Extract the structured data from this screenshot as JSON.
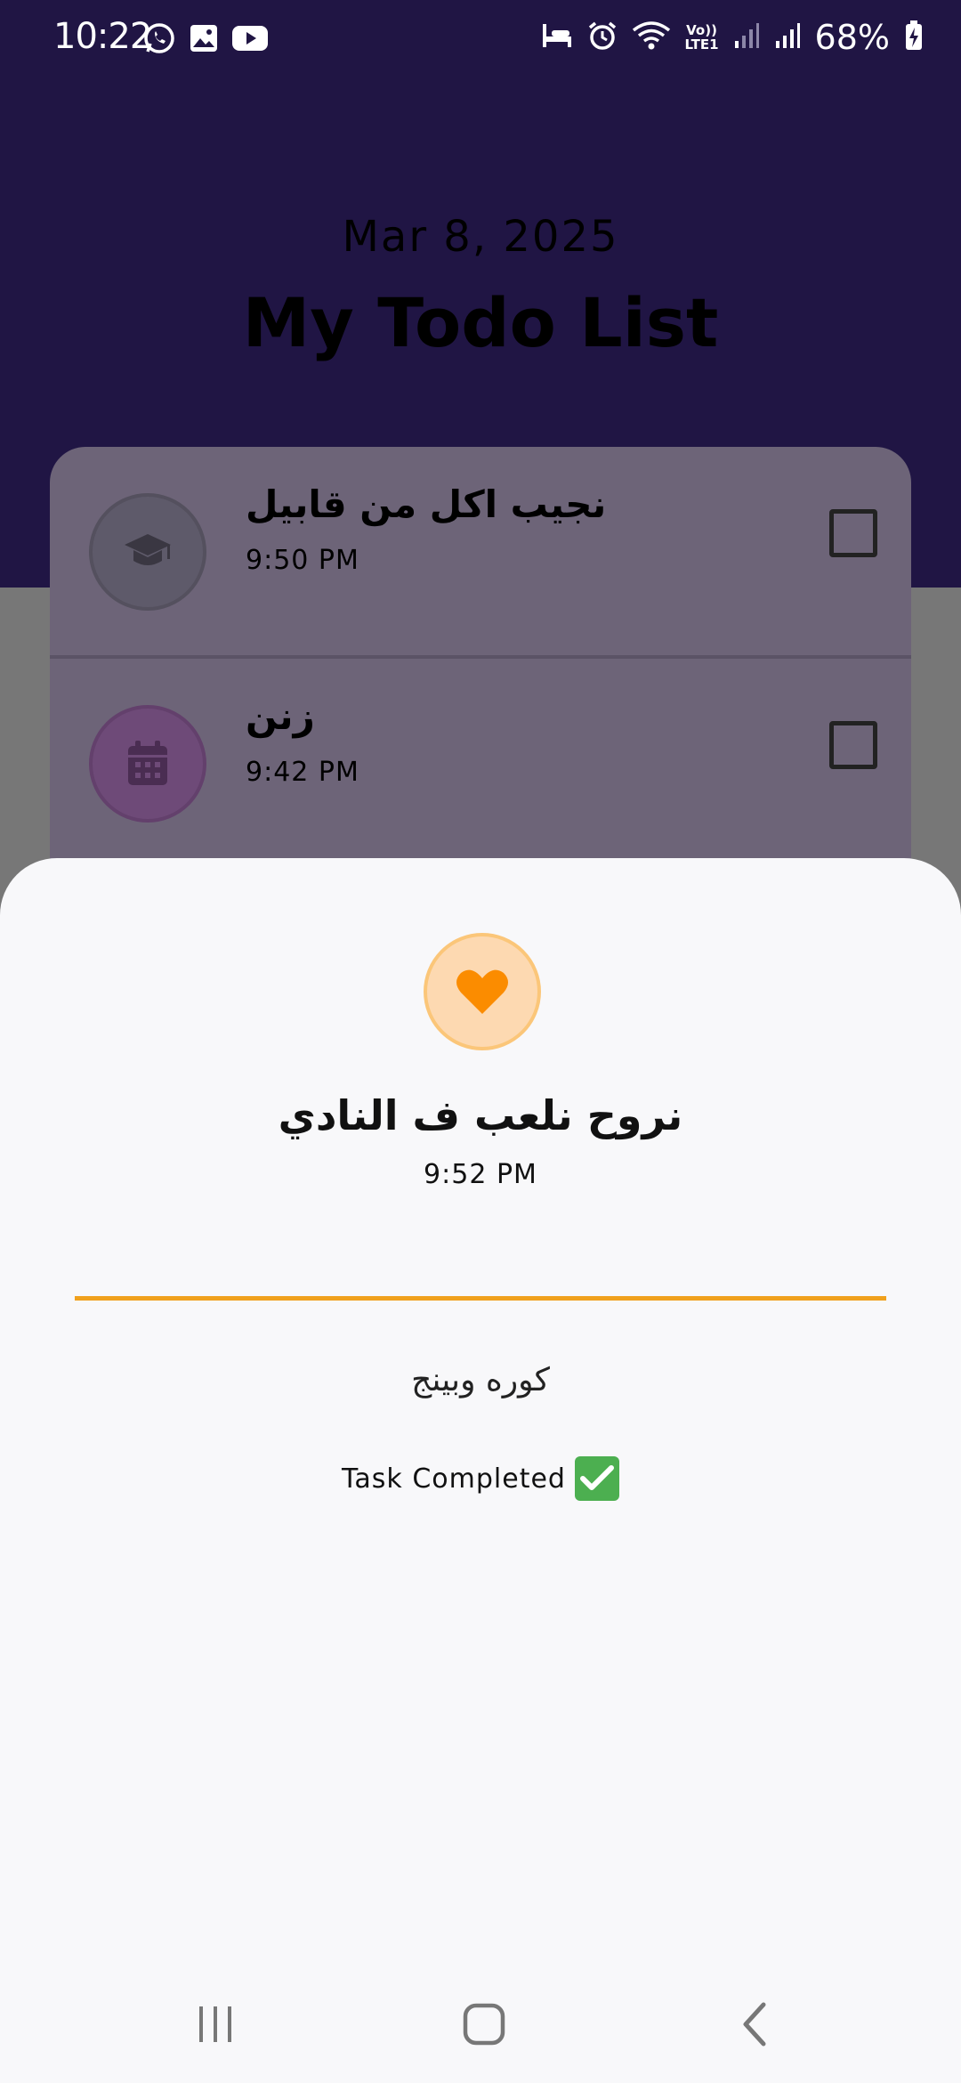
{
  "status_bar": {
    "time": "10:22",
    "left_icons": [
      "whatsapp-icon",
      "gallery-icon",
      "youtube-icon"
    ],
    "right_icons": [
      "sleep-mode-icon",
      "alarm-icon",
      "wifi-icon",
      "volte-icon",
      "signal-icon",
      "signal-icon-2",
      "battery-charging-icon"
    ],
    "volte_label": "Vo))\nLTE1",
    "battery_percent": "68%"
  },
  "header": {
    "date": "Mar 8, 2025",
    "title": "My Todo List"
  },
  "tasks": [
    {
      "title": "نجيب اكل من قابيل",
      "time": "9:50 PM",
      "icon": "graduation-cap-icon",
      "icon_bg": "#5e5a6a",
      "icon_border": "#54505e",
      "icon_color": "#3a3742",
      "checked": false
    },
    {
      "title": "زنن",
      "time": "9:42 PM",
      "icon": "calendar-icon",
      "icon_bg": "#6e4a78",
      "icon_border": "#63406c",
      "icon_color": "#4a2d52",
      "checked": false
    }
  ],
  "detail_sheet": {
    "icon": "heart-icon",
    "accent": "#f0a11d",
    "title": "نروح نلعب ف النادي",
    "time": "9:52 PM",
    "description": "كوره وبينج",
    "completed_label": "Task Completed",
    "completed": true
  },
  "nav_bar": {
    "buttons": [
      "recents-icon",
      "home-icon",
      "back-icon"
    ]
  }
}
